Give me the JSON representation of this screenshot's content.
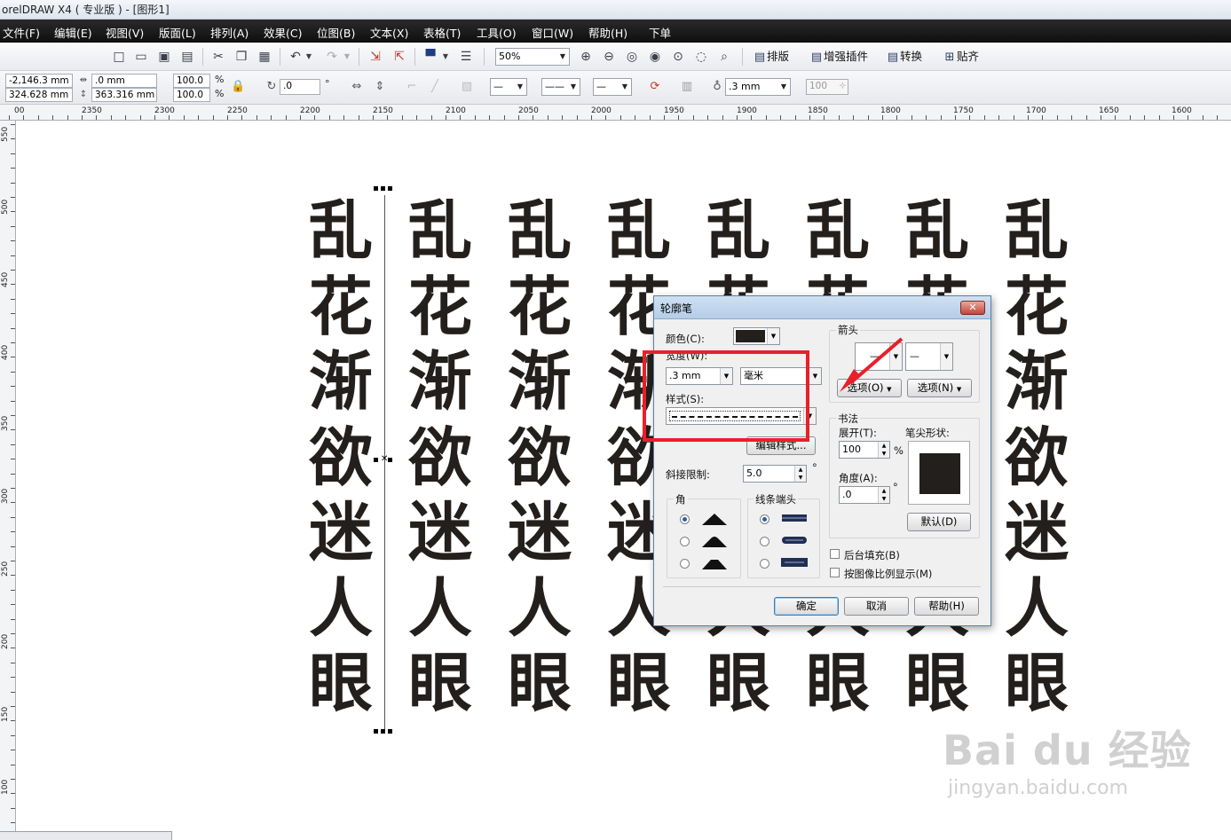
{
  "window": {
    "title": "orelDRAW X4 ( 专业版 ) - [图形1]"
  },
  "menu": [
    "文件(F)",
    "编辑(E)",
    "视图(V)",
    "版面(L)",
    "排列(A)",
    "效果(C)",
    "位图(B)",
    "文本(X)",
    "表格(T)",
    "工具(O)",
    "窗口(W)",
    "帮助(H)",
    "下单"
  ],
  "toolbar": {
    "zoom": "50%",
    "buttons": [
      "排版",
      "增强插件",
      "转换",
      "贴齐"
    ]
  },
  "propbar": {
    "x": "-2,146.3 mm",
    "y": "324.628 mm",
    "width": ".0 mm",
    "height": "363.316 mm",
    "scale_w": "100.0",
    "scale_h": "100.0",
    "percent": "%",
    "rotation": ".0",
    "degree": "°",
    "outline_width": ".3 mm",
    "opacity": "100"
  },
  "ruler": {
    "h_labels": [
      "00",
      "2350",
      "2300",
      "2250",
      "2200",
      "2150",
      "2100",
      "2050",
      "2000",
      "1950",
      "1900",
      "1850",
      "1800",
      "1750",
      "1700",
      "1650",
      "1600"
    ],
    "v_labels": [
      "550",
      "500",
      "450",
      "400",
      "350",
      "300",
      "250",
      "200",
      "150",
      "100"
    ]
  },
  "canvas": {
    "column_text": [
      "乱",
      "花",
      "渐",
      "欲",
      "迷",
      "人",
      "眼"
    ],
    "columns": 8
  },
  "dialog": {
    "title": "轮廓笔",
    "close": "✕",
    "color_label": "颜色(C):",
    "color_value": "#231f1c",
    "width_label": "宽度(W):",
    "width_value": ".3 mm",
    "unit_value": "毫米",
    "style_label": "样式(S):",
    "edit_style_button": "编辑样式...",
    "miter_label": "斜接限制:",
    "miter_value": "5.0",
    "miter_unit": "°",
    "corner_label": "角",
    "linecap_label": "线条端头",
    "arrow_label": "箭头",
    "arrow_options_left": "选项(O)",
    "arrow_options_right": "选项(N)",
    "calligraphy_label": "书法",
    "stretch_label": "展开(T):",
    "stretch_value": "100",
    "stretch_unit": "%",
    "angle_label": "角度(A):",
    "angle_value": ".0",
    "angle_unit": "°",
    "nib_label": "笔尖形状:",
    "default_button": "默认(D)",
    "behind_fill_label": "后台填充(B)",
    "scale_with_image_label": "按图像比例显示(M)",
    "ok_button": "确定",
    "cancel_button": "取消",
    "help_button": "帮助(H)"
  },
  "watermark": {
    "brand": "Bai du 经验",
    "url": "jingyan.baidu.com"
  },
  "colors": {
    "annotation_red": "#e8202a",
    "glyph": "#231f1c",
    "menubar": "#161616"
  }
}
